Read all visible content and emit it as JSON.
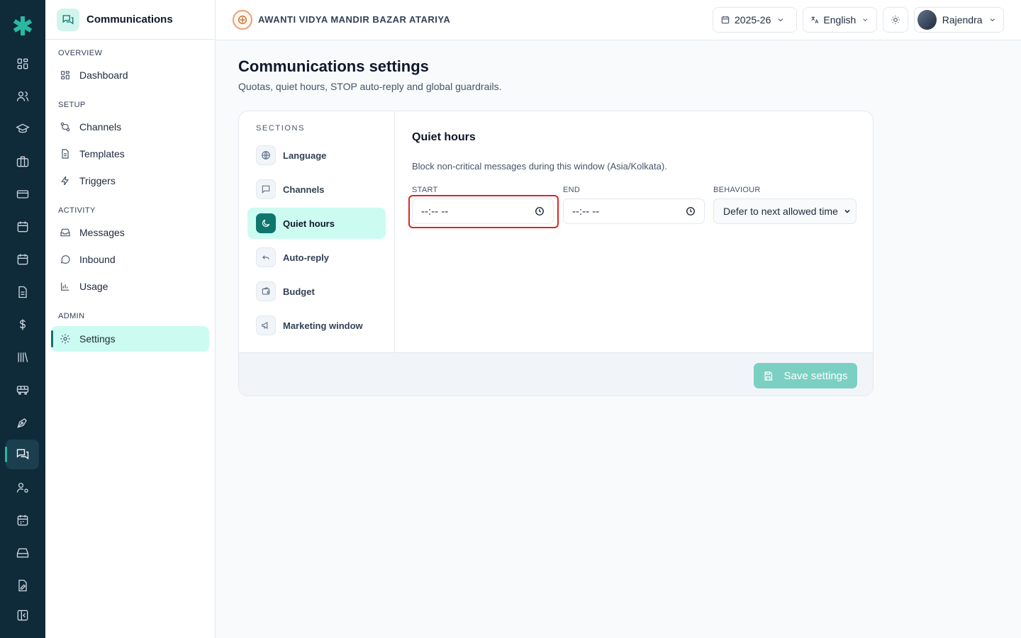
{
  "colors": {
    "rail_bg": "#0f2a38",
    "accent": "#0f766e",
    "accent_light": "#ccfbf1",
    "highlight": "#dc2626",
    "save_button": "#7ccfc3"
  },
  "rail": {
    "items": [
      "dashboard-icon",
      "users-icon",
      "graduation-cap-icon",
      "briefcase-icon",
      "credit-card-icon",
      "calendar-icon",
      "calendar-alt-icon",
      "document-icon",
      "dollar-icon",
      "library-icon",
      "bus-icon",
      "pen-tool-icon",
      "communications-icon",
      "user-cog-icon",
      "schedule-icon",
      "storage-icon",
      "file-edit-icon",
      "collapse-sidebar-icon"
    ],
    "active": "communications-icon"
  },
  "sidebar": {
    "title": "Communications",
    "sections": {
      "overview": "OVERVIEW",
      "setup": "SETUP",
      "activity": "ACTIVITY",
      "admin": "ADMIN"
    },
    "items": {
      "dashboard": "Dashboard",
      "channels": "Channels",
      "templates": "Templates",
      "triggers": "Triggers",
      "messages": "Messages",
      "inbound": "Inbound",
      "usage": "Usage",
      "settings": "Settings"
    },
    "active": "Settings"
  },
  "topbar": {
    "org_name": "AWANTI VIDYA MANDIR BAZAR ATARIYA",
    "year": "2025-26",
    "language": "English",
    "user": "Rajendra"
  },
  "page": {
    "title": "Communications settings",
    "subtitle": "Quotas, quiet hours, STOP auto-reply and global guardrails."
  },
  "sections_nav": {
    "heading": "SECTIONS",
    "items": [
      "Language",
      "Channels",
      "Quiet hours",
      "Auto-reply",
      "Budget",
      "Marketing window"
    ],
    "active": "Quiet hours"
  },
  "panel": {
    "title": "Quiet hours",
    "description": "Block non-critical messages during this window (Asia/Kolkata).",
    "start_label": "START",
    "start_value": "--:-- --",
    "end_label": "END",
    "end_value": "--:-- --",
    "behaviour_label": "BEHAVIOUR",
    "behaviour_value": "Defer to next allowed time"
  },
  "footer": {
    "save_label": "Save settings"
  }
}
